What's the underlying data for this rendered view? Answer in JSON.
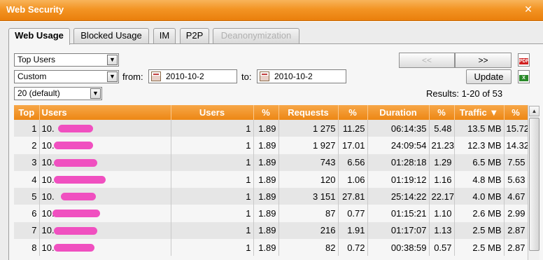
{
  "window": {
    "title": "Web Security",
    "close_glyph": "✕"
  },
  "tabs": [
    {
      "label": "Web Usage",
      "state": "active"
    },
    {
      "label": "Blocked Usage",
      "state": "normal"
    },
    {
      "label": "IM",
      "state": "normal"
    },
    {
      "label": "P2P",
      "state": "normal"
    },
    {
      "label": "Deanonymization",
      "state": "disabled"
    }
  ],
  "filters": {
    "report_type": "Top Users",
    "period": "Custom",
    "limit": "20 (default)",
    "from_label": "from:",
    "from_value": "2010-10-2",
    "to_label": "to:",
    "to_value": "2010-10-2"
  },
  "nav": {
    "prev_label": "<<",
    "next_label": ">>",
    "update_label": "Update"
  },
  "export_icons": {
    "pdf": "PDF",
    "excel": "X"
  },
  "results_text": "Results: 1-20 of 53",
  "table": {
    "columns": [
      "Top",
      "Users",
      "Users",
      "%",
      "Requests",
      "%",
      "Duration",
      "%",
      "Traffic ▼",
      "%"
    ],
    "rows": [
      {
        "top": "1",
        "user": "10.",
        "users": "1",
        "users_pct": "1.89",
        "requests": "1 275",
        "req_pct": "11.25",
        "duration": "06:14:35",
        "dur_pct": "5.48",
        "traffic": "13.5 MB",
        "traf_pct": "15.72"
      },
      {
        "top": "2",
        "user": "10.",
        "users": "1",
        "users_pct": "1.89",
        "requests": "1 927",
        "req_pct": "17.01",
        "duration": "24:09:54",
        "dur_pct": "21.23",
        "traffic": "12.3 MB",
        "traf_pct": "14.32"
      },
      {
        "top": "3",
        "user": "10.",
        "users": "1",
        "users_pct": "1.89",
        "requests": "743",
        "req_pct": "6.56",
        "duration": "01:28:18",
        "dur_pct": "1.29",
        "traffic": "6.5 MB",
        "traf_pct": "7.55"
      },
      {
        "top": "4",
        "user": "10.",
        "users": "1",
        "users_pct": "1.89",
        "requests": "120",
        "req_pct": "1.06",
        "duration": "01:19:12",
        "dur_pct": "1.16",
        "traffic": "4.8 MB",
        "traf_pct": "5.63"
      },
      {
        "top": "5",
        "user": "10.",
        "users": "1",
        "users_pct": "1.89",
        "requests": "3 151",
        "req_pct": "27.81",
        "duration": "25:14:22",
        "dur_pct": "22.17",
        "traffic": "4.0 MB",
        "traf_pct": "4.67"
      },
      {
        "top": "6",
        "user": "10.",
        "users": "1",
        "users_pct": "1.89",
        "requests": "87",
        "req_pct": "0.77",
        "duration": "01:15:21",
        "dur_pct": "1.10",
        "traffic": "2.6 MB",
        "traf_pct": "2.99"
      },
      {
        "top": "7",
        "user": "10.",
        "users": "1",
        "users_pct": "1.89",
        "requests": "216",
        "req_pct": "1.91",
        "duration": "01:17:07",
        "dur_pct": "1.13",
        "traffic": "2.5 MB",
        "traf_pct": "2.87"
      },
      {
        "top": "8",
        "user": "10.",
        "users": "1",
        "users_pct": "1.89",
        "requests": "82",
        "req_pct": "0.72",
        "duration": "00:38:59",
        "dur_pct": "0.57",
        "traffic": "2.5 MB",
        "traf_pct": "2.87"
      }
    ]
  },
  "colors": {
    "accent": "#f39424",
    "redaction": "#f050c0"
  }
}
